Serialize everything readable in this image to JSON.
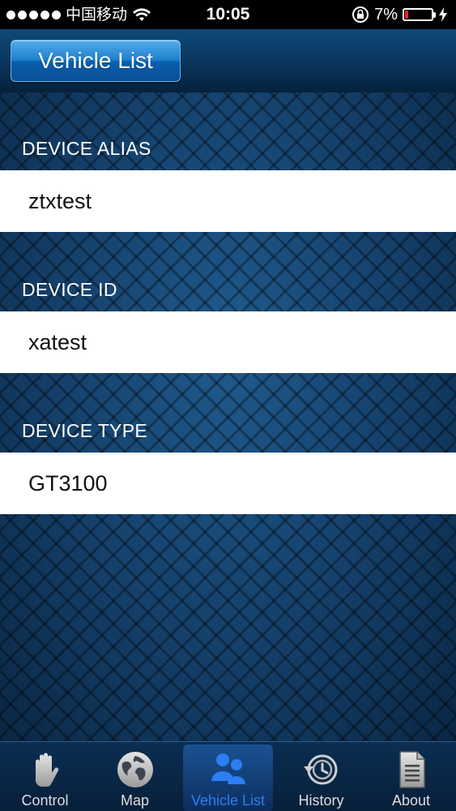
{
  "status_bar": {
    "carrier": "中国移动",
    "time": "10:05",
    "battery_percent": "7%",
    "battery_level": 0.07,
    "battery_color": "#e8252a"
  },
  "header": {
    "title": "Vehicle List"
  },
  "fields": [
    {
      "label": "DEVICE ALIAS",
      "value": "ztxtest"
    },
    {
      "label": "DEVICE ID",
      "value": "xatest"
    },
    {
      "label": "DEVICE TYPE",
      "value": "GT3100"
    }
  ],
  "tabs": [
    {
      "label": "Control",
      "icon": "hand-icon"
    },
    {
      "label": "Map",
      "icon": "globe-icon"
    },
    {
      "label": "Vehicle List",
      "icon": "users-icon",
      "active": true
    },
    {
      "label": "History",
      "icon": "history-icon"
    },
    {
      "label": "About",
      "icon": "document-icon"
    }
  ],
  "colors": {
    "accent": "#2c7ef2",
    "title_button": "#1d7fcc"
  }
}
